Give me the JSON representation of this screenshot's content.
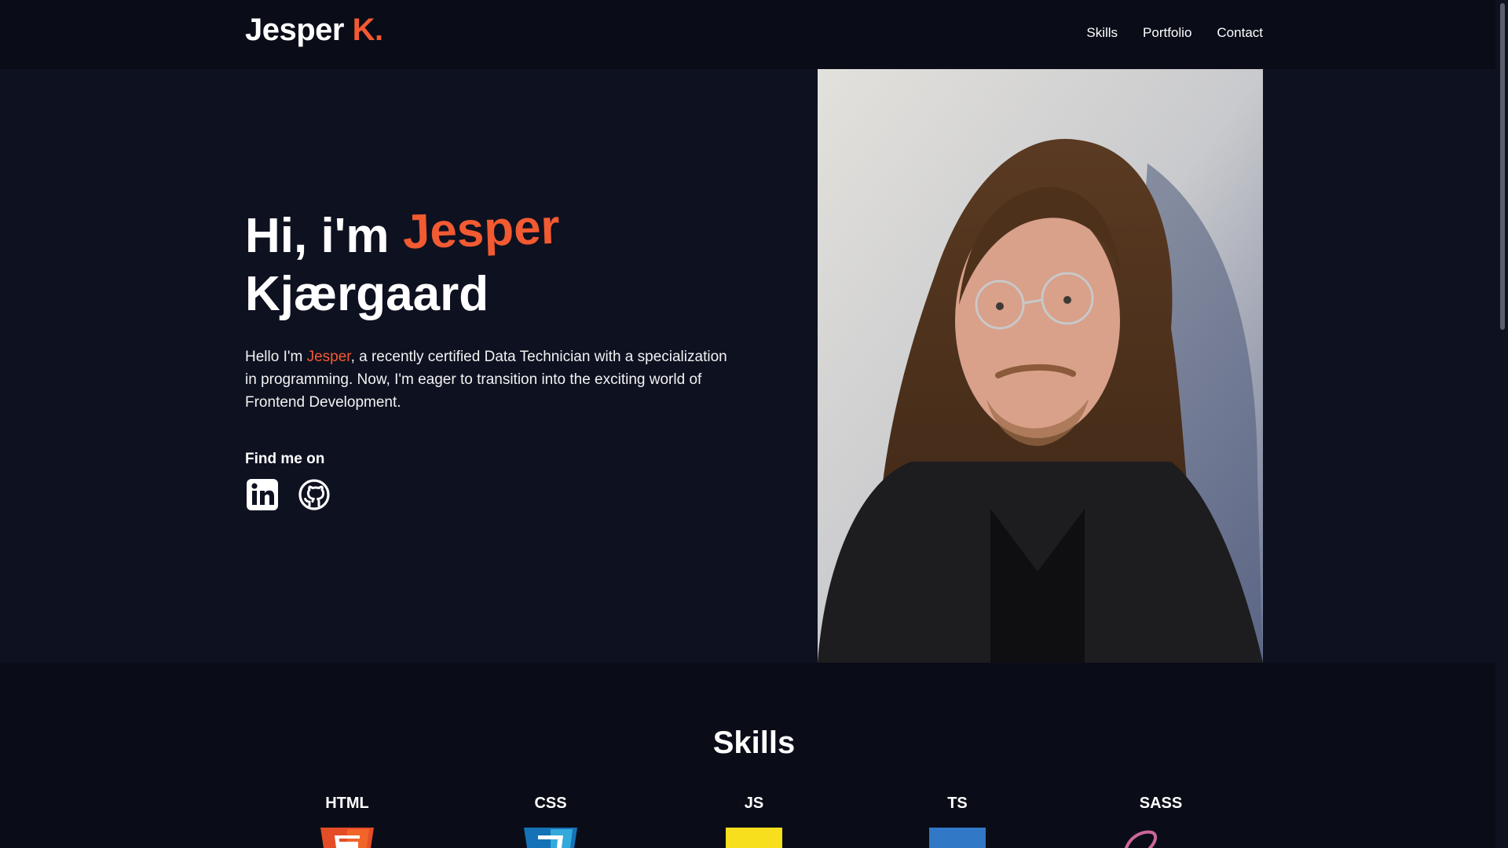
{
  "nav": {
    "logo_first": "Jesper",
    "logo_accent": "K.",
    "links": [
      "Skills",
      "Portfolio",
      "Contact"
    ]
  },
  "hero": {
    "greeting": "Hi, i'm",
    "first_name": "Jesper",
    "last_name": "Kjærgaard",
    "intro_prefix": "Hello I'm ",
    "intro_name": "Jesper",
    "intro_suffix": ", a recently certified Data Technician with a specialization in programming. Now, I'm eager to transition into the exciting world of Frontend Development.",
    "find_me": "Find me on"
  },
  "skills": {
    "title": "Skills",
    "items": [
      "HTML",
      "CSS",
      "JS",
      "TS",
      "SASS"
    ]
  },
  "colors": {
    "accent": "#f25a32",
    "background": "#0e1120",
    "navbar": "#0a0d18",
    "html": "#e44d26",
    "css": "#1572b6",
    "js": "#f7df1e",
    "ts": "#3178c6",
    "sass": "#cc6699"
  },
  "icons": {
    "linkedin": "linkedin-icon",
    "github": "github-icon"
  }
}
